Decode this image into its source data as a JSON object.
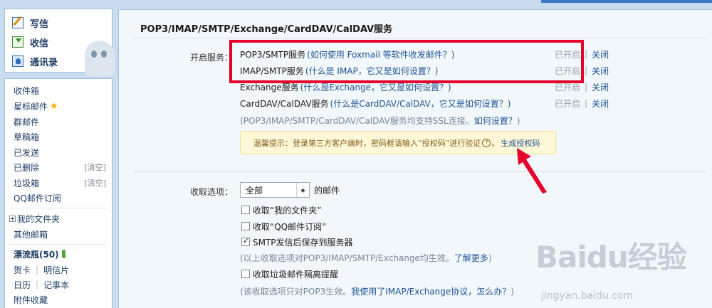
{
  "quick_actions": [
    {
      "label": "写信",
      "icon": "compose-icon"
    },
    {
      "label": "收信",
      "icon": "inbox-download-icon"
    },
    {
      "label": "通讯录",
      "icon": "address-book-icon"
    }
  ],
  "folders": {
    "inbox": "收件箱",
    "starred": "星标邮件",
    "group": "群邮件",
    "drafts": "草稿箱",
    "sent": "已发送",
    "deleted": "已删除",
    "spam": "垃圾箱",
    "clear_label": "[清空]",
    "qq_subscribe": "QQ邮件订阅",
    "my_folders": "我的文件夹",
    "other_mailbox": "其他邮箱",
    "drift_bottle": "漂流瓶(50)",
    "greeting_card": "贺卡",
    "postcard": "明信片",
    "calendar": "日历",
    "notebook": "记事本",
    "attachments": "附件收藏"
  },
  "page": {
    "title": "POP3/IMAP/SMTP/Exchange/CardDAV/CalDAV服务",
    "enable_label": "开启服务：",
    "services": [
      {
        "name": "POP3/SMTP服务",
        "help": "(如何使用 Foxmail 等软件收发邮件？)",
        "state": "已开启",
        "action": "关闭"
      },
      {
        "name": "IMAP/SMTP服务",
        "help": "(什么是 IMAP，它又是如何设置？)",
        "state": "已开启",
        "action": "关闭"
      },
      {
        "name": "Exchange服务",
        "help": "(什么是Exchange，它又是如何设置？)",
        "state": "已开启",
        "action": "关闭"
      },
      {
        "name": "CardDAV/CalDAV服务",
        "help": "(什么是CardDAV/CalDAV，它又是如何设置？)",
        "state": "已开启",
        "action": "关闭"
      }
    ],
    "ssl_note": "(POP3/IMAP/SMTP/CardDAV/CalDAV服务均支持SSL连接。",
    "ssl_link": "如何设置？",
    "ssl_note_end": ")",
    "tip_text": "温馨提示：登录第三方客户端时，密码框请输入“授权码”进行验证",
    "tip_help": "?",
    "tip_link": "生成授权码",
    "receive_label": "收取选项：",
    "receive_select": "全部",
    "receive_suffix": "的邮件",
    "options": [
      {
        "label": "收取“我的文件夹”",
        "checked": false
      },
      {
        "label": "收取“QQ邮件订阅”",
        "checked": false
      },
      {
        "label": "SMTP发信后保存到服务器",
        "checked": true
      }
    ],
    "options_note": "(以上收取选项对POP3/IMAP/SMTP/Exchange均生效。",
    "options_note_link": "了解更多",
    "options_note_end": ")",
    "spam_option": {
      "label": "收取垃圾邮件隔离提醒",
      "checked": false
    },
    "spam_note": "(该收取选项只对POP3生效。",
    "spam_note_link": "我使用了IMAP/Exchange协议，怎么办？",
    "spam_note_end": ")"
  },
  "watermark": {
    "brand": "Baidu经验",
    "url": "jingyan.baidu.com"
  },
  "colors": {
    "annotation_red": "#e4002b",
    "link_blue": "#1e5494",
    "panel_bg": "#f2f7fc"
  }
}
